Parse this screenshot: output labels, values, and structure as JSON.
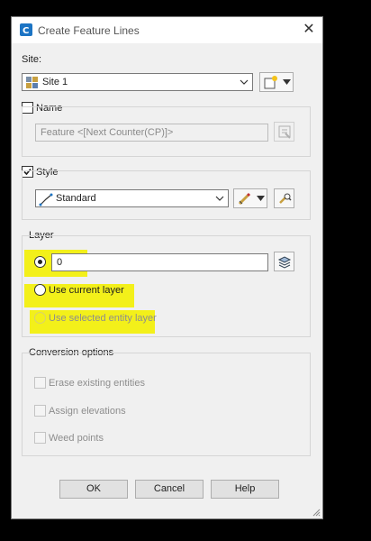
{
  "window": {
    "title": "Create Feature Lines",
    "close_glyph": "✕"
  },
  "site": {
    "label": "Site:",
    "value": "Site 1"
  },
  "name": {
    "label": "Name",
    "checked": false,
    "value": "Feature <[Next Counter(CP)]>"
  },
  "style": {
    "label": "Style",
    "checked": true,
    "value": "Standard"
  },
  "layer": {
    "group_label": "Layer",
    "value": "0",
    "option_current": "Use current layer",
    "option_selected": "Use selected entity layer",
    "selected_option": "specified"
  },
  "conversion": {
    "group_label": "Conversion options",
    "erase": "Erase existing entities",
    "assign": "Assign elevations",
    "weed": "Weed points"
  },
  "buttons": {
    "ok": "OK",
    "cancel": "Cancel",
    "help": "Help"
  },
  "colors": {
    "highlight": "#f3f01a",
    "accent": "#1c74c4"
  }
}
